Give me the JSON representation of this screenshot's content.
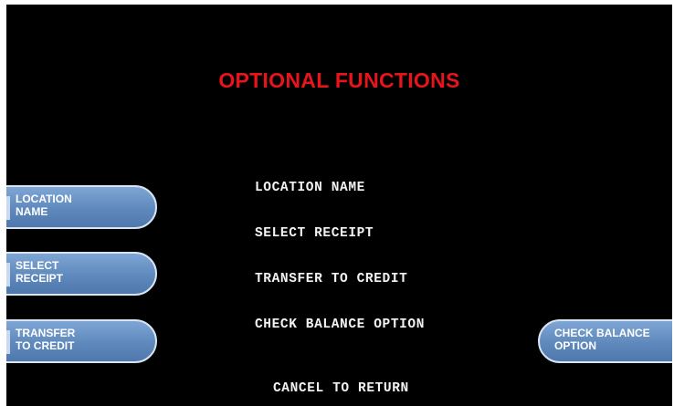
{
  "screen": {
    "title": "OPTIONAL FUNCTIONS",
    "title_color": "#e8141b",
    "background": "#000000"
  },
  "menu_lines": [
    "LOCATION NAME",
    "SELECT RECEIPT",
    "TRANSFER TO CREDIT",
    "CHECK BALANCE OPTION"
  ],
  "cancel_text": "CANCEL TO RETURN",
  "buttons": {
    "location_name": {
      "line1": "LOCATION",
      "line2": "NAME"
    },
    "select_receipt": {
      "line1": "SELECT",
      "line2": "RECEIPT"
    },
    "transfer_to_credit": {
      "line1": "TRANSFER",
      "line2": "TO CREDIT"
    },
    "check_balance_option": {
      "line1": "CHECK BALANCE",
      "line2": "OPTION"
    }
  },
  "colors": {
    "button_fill": "#6690c4",
    "button_border": "#d8e4f4",
    "text": "#f2f2f2"
  }
}
